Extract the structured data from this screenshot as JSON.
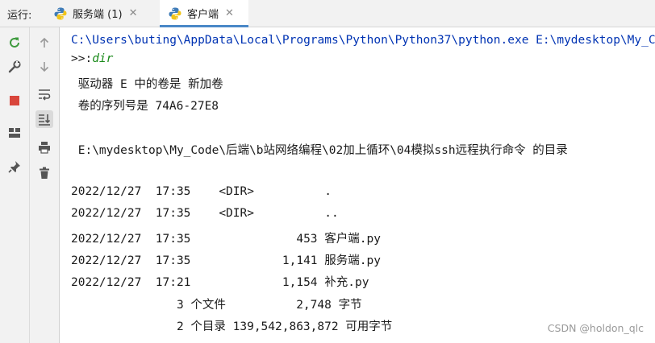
{
  "runbar": {
    "label": "运行:",
    "tabs": [
      {
        "label": "服务端 (1)",
        "close": "✕"
      },
      {
        "label": "客户端",
        "close": "✕"
      }
    ]
  },
  "console": {
    "path_line": "C:\\Users\\buting\\AppData\\Local\\Programs\\Python\\Python37\\python.exe E:\\mydesktop\\My_Code\\后端\\b站网络编程\\02加上循环\\04模拟ssh远程执行命令\\客户端.py",
    "prompt": ">>:",
    "command": "dir",
    "lines": [
      " 驱动器 E 中的卷是 新加卷",
      " 卷的序列号是 74A6-27E8",
      "",
      " E:\\mydesktop\\My_Code\\后端\\b站网络编程\\02加上循环\\04模拟ssh远程执行命令 的目录",
      "",
      "2022/12/27  17:35    <DIR>          .",
      "2022/12/27  17:35    <DIR>          ..",
      "2022/12/27  17:35               453 客户端.py",
      "2022/12/27  17:35             1,141 服务端.py",
      "2022/12/27  17:21             1,154 补充.py",
      "               3 个文件          2,748 字节",
      "               2 个目录 139,542,863,872 可用字节"
    ]
  },
  "watermark": "CSDN @holdon_qlc",
  "colors": {
    "accent": "#4a88c7",
    "rerun": "#3d9a3d",
    "stop": "#d9463c",
    "path": "#0033b3"
  }
}
